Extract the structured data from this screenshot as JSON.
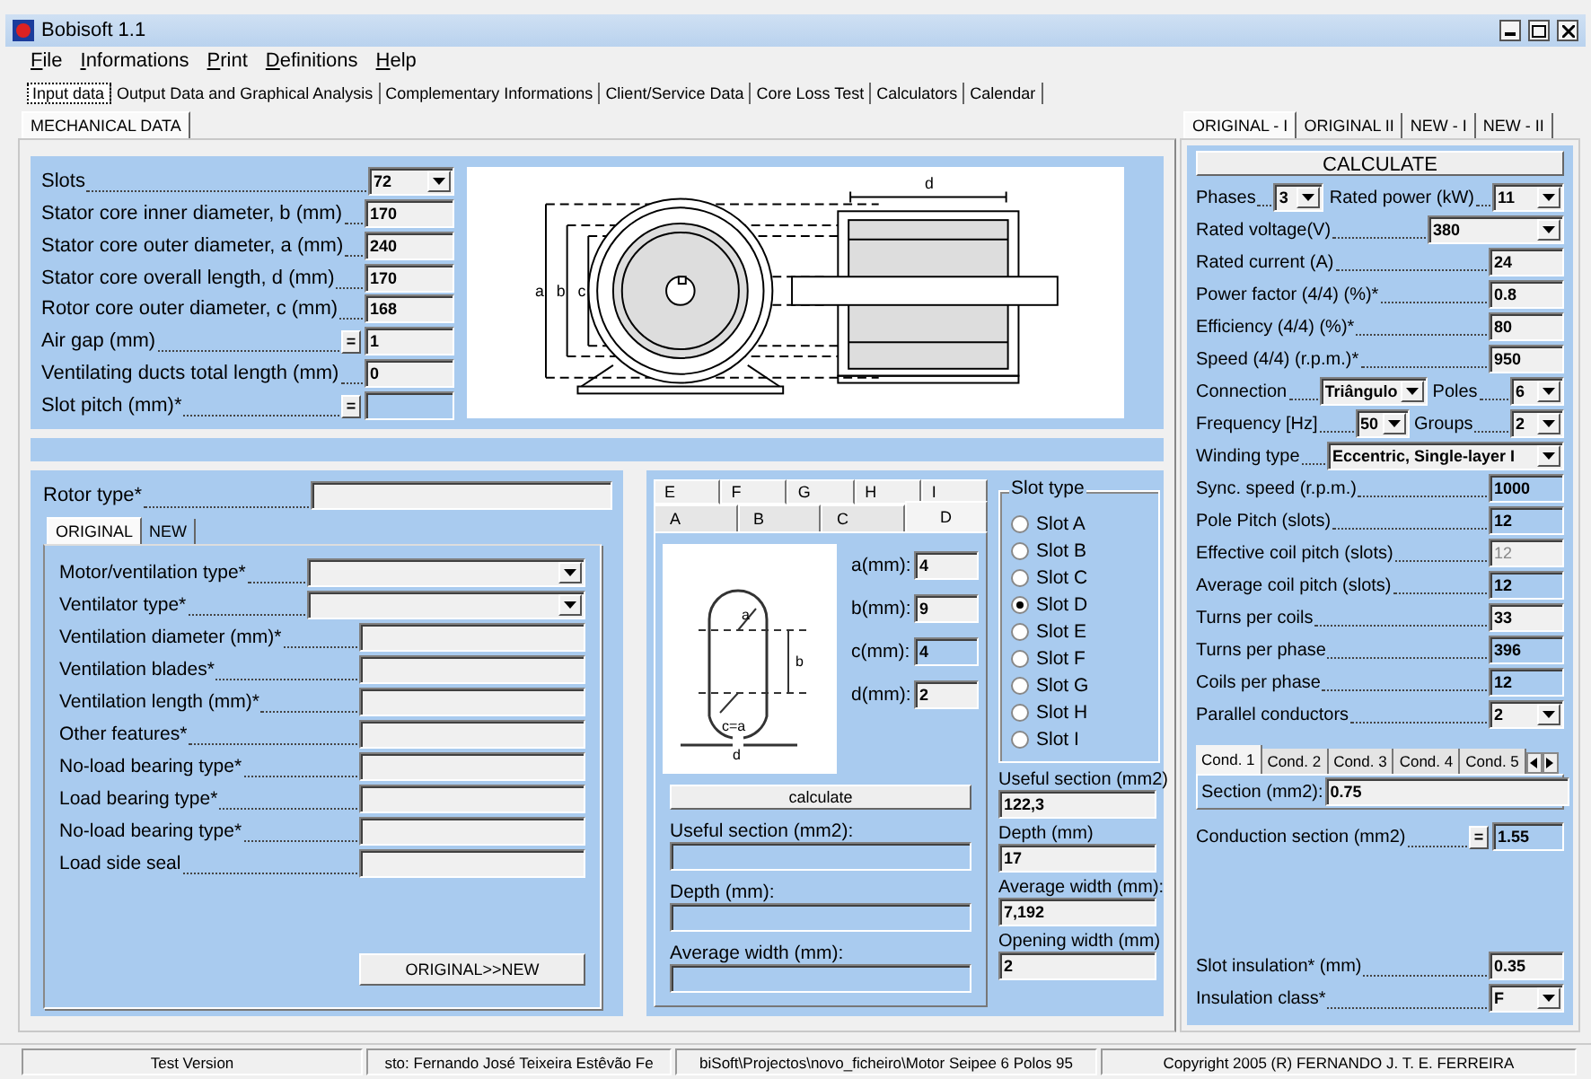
{
  "window": {
    "title": "Bobisoft 1.1"
  },
  "menu": [
    "File",
    "Informations",
    "Print",
    "Definitions",
    "Help"
  ],
  "main_tabs": [
    {
      "label": "Input data",
      "selected": true
    },
    {
      "label": "Output Data and Graphical Analysis",
      "selected": false
    },
    {
      "label": "Complementary Informations",
      "selected": false
    },
    {
      "label": "Client/Service Data",
      "selected": false
    },
    {
      "label": "Core Loss Test",
      "selected": false
    },
    {
      "label": "Calculators",
      "selected": false
    },
    {
      "label": "Calendar",
      "selected": false
    }
  ],
  "section_tabs": [
    {
      "label": "MECHANICAL DATA",
      "selected": true
    }
  ],
  "mechanical_fields": [
    {
      "label": "Slots",
      "value": "72",
      "kind": "select"
    },
    {
      "label": "Stator core inner diameter, b (mm)",
      "value": "170",
      "kind": "text"
    },
    {
      "label": "Stator core outer diameter, a (mm)",
      "value": "240",
      "kind": "text"
    },
    {
      "label": "Stator core overall length, d (mm)",
      "value": "170",
      "kind": "text"
    },
    {
      "label": "Rotor core outer diameter, c (mm)",
      "value": "168",
      "kind": "text"
    },
    {
      "label": "Air gap (mm)",
      "value": "1",
      "kind": "text",
      "button": "="
    },
    {
      "label": "Ventilating ducts total length (mm)",
      "value": "0",
      "kind": "text"
    },
    {
      "label": "Slot pitch (mm)*",
      "kind": "output",
      "button": "="
    }
  ],
  "motor_drawing_labels": [
    "a",
    "b",
    "c",
    "d"
  ],
  "rotor": {
    "label": "Rotor type*"
  },
  "ventilation_tabs": [
    {
      "label": "ORIGINAL",
      "selected": true
    },
    {
      "label": "NEW",
      "selected": false
    }
  ],
  "ventilation_fields": [
    {
      "label": "Motor/ventilation type*",
      "kind": "select"
    },
    {
      "label": "Ventilator type*",
      "kind": "select"
    },
    {
      "label": "Ventilation diameter (mm)*",
      "kind": "text"
    },
    {
      "label": "Ventilation blades*",
      "kind": "text"
    },
    {
      "label": "Ventilation length (mm)*",
      "kind": "text"
    },
    {
      "label": "Other features*",
      "kind": "text"
    },
    {
      "label": "No-load bearing type*",
      "kind": "text"
    },
    {
      "label": "Load bearing type*",
      "kind": "text"
    },
    {
      "label": "No-load bearing type*",
      "kind": "text"
    },
    {
      "label": "Load side seal",
      "kind": "text"
    }
  ],
  "copy_button": "ORIGINAL>>NEW",
  "slot_tabs_back": [
    {
      "label": "E",
      "selected": false
    },
    {
      "label": "F",
      "selected": false
    },
    {
      "label": "G",
      "selected": false
    },
    {
      "label": "H",
      "selected": false
    },
    {
      "label": "I",
      "selected": false
    }
  ],
  "slot_tabs_front": [
    {
      "label": "A",
      "selected": false
    },
    {
      "label": "B",
      "selected": false
    },
    {
      "label": "C",
      "selected": false
    },
    {
      "label": "D",
      "selected": true
    }
  ],
  "slot_drawing_labels": [
    "a",
    "b",
    "c=a",
    "d"
  ],
  "slot_dimensions": [
    {
      "label": "a(mm):",
      "value": "4",
      "kind": "text"
    },
    {
      "label": "b(mm):",
      "value": "9",
      "kind": "text"
    },
    {
      "label": "c(mm):",
      "value": "4",
      "kind": "output"
    },
    {
      "label": "d(mm):",
      "value": "2",
      "kind": "text"
    }
  ],
  "calculate_button": "calculate",
  "results_left": [
    {
      "label": "Useful section (mm2):"
    },
    {
      "label": "Depth (mm):"
    },
    {
      "label": "Average width (mm):"
    }
  ],
  "slot_type": {
    "title": "Slot type",
    "options": [
      {
        "label": "Slot A",
        "selected": false
      },
      {
        "label": "Slot B",
        "selected": false
      },
      {
        "label": "Slot C",
        "selected": false
      },
      {
        "label": "Slot D",
        "selected": true
      },
      {
        "label": "Slot E",
        "selected": false
      },
      {
        "label": "Slot F",
        "selected": false
      },
      {
        "label": "Slot G",
        "selected": false
      },
      {
        "label": "Slot H",
        "selected": false
      },
      {
        "label": "Slot I",
        "selected": false
      }
    ]
  },
  "results_right": [
    {
      "label": "Useful section (mm2)",
      "value": "122,3"
    },
    {
      "label": "Depth (mm)",
      "value": "17"
    },
    {
      "label": "Average width (mm):",
      "value": "7,192"
    },
    {
      "label": "Opening width (mm)",
      "value": "2"
    }
  ],
  "right_tabs": [
    {
      "label": "ORIGINAL - I",
      "selected": true
    },
    {
      "label": "ORIGINAL II",
      "selected": false
    },
    {
      "label": "NEW - I",
      "selected": false
    },
    {
      "label": "NEW - II",
      "selected": false
    }
  ],
  "right_calculate_button": "CALCULATE",
  "electrical_rows": [
    {
      "fields": [
        {
          "label": "Phases",
          "value": "3",
          "kind": "select"
        },
        {
          "label": "Rated power (kW)",
          "value": "11",
          "kind": "select"
        }
      ]
    },
    {
      "fields": [
        {
          "label": "Rated voltage(V)",
          "value": "380",
          "kind": "select"
        }
      ]
    },
    {
      "fields": [
        {
          "label": "Rated current (A)",
          "value": "24",
          "kind": "text"
        }
      ]
    },
    {
      "fields": [
        {
          "label": "Power factor (4/4) (%)*",
          "value": "0.8",
          "kind": "text"
        }
      ]
    },
    {
      "fields": [
        {
          "label": "Efficiency (4/4) (%)*",
          "value": "80",
          "kind": "text"
        }
      ]
    },
    {
      "fields": [
        {
          "label": "Speed (4/4) (r.p.m.)*",
          "value": "950",
          "kind": "text"
        }
      ]
    },
    {
      "fields": [
        {
          "label": "Connection",
          "value": "Triângulo",
          "kind": "select"
        },
        {
          "label": "Poles",
          "value": "6",
          "kind": "select"
        }
      ]
    },
    {
      "fields": [
        {
          "label": "Frequency [Hz]",
          "value": "50",
          "kind": "select"
        },
        {
          "label": "Groups",
          "value": "2",
          "kind": "select"
        }
      ]
    },
    {
      "fields": [
        {
          "label": "Winding type",
          "value": "Eccentric, Single-layer I",
          "kind": "select"
        }
      ]
    },
    {
      "fields": [
        {
          "label": "Sync. speed (r.p.m.)",
          "value": "1000",
          "kind": "output"
        }
      ]
    },
    {
      "fields": [
        {
          "label": "Pole Pitch (slots)",
          "value": "12",
          "kind": "output"
        }
      ]
    },
    {
      "fields": [
        {
          "label": "Effective coil pitch (slots)",
          "value": "12",
          "kind": "disabled"
        }
      ]
    },
    {
      "fields": [
        {
          "label": "Average coil pitch (slots)",
          "value": "12",
          "kind": "output"
        }
      ]
    },
    {
      "fields": [
        {
          "label": "Turns per coils",
          "value": "33",
          "kind": "text"
        }
      ]
    },
    {
      "fields": [
        {
          "label": "Turns per phase",
          "value": "396",
          "kind": "output"
        }
      ]
    },
    {
      "fields": [
        {
          "label": "Coils per phase",
          "value": "12",
          "kind": "output"
        }
      ]
    },
    {
      "fields": [
        {
          "label": "Parallel conductors",
          "value": "2",
          "kind": "select"
        }
      ]
    }
  ],
  "conductor_tabs": [
    {
      "label": "Cond. 1",
      "selected": true
    },
    {
      "label": "Cond. 2",
      "selected": false
    },
    {
      "label": "Cond. 3",
      "selected": false
    },
    {
      "label": "Cond. 4",
      "selected": false
    },
    {
      "label": "Cond. 5",
      "selected": false
    }
  ],
  "conductor_section": {
    "label": "Section (mm2):",
    "value": "0.75"
  },
  "conduction_section": {
    "label": "Conduction section (mm2)",
    "value": "1.55",
    "kind": "output",
    "button": "="
  },
  "insulation_fields": [
    {
      "label": "Slot insulation* (mm)",
      "value": "0.35",
      "kind": "text"
    },
    {
      "label": "Insulation class*",
      "value": "F",
      "kind": "select"
    }
  ],
  "status_bar": [
    "Test Version",
    "sto: Fernando José Teixeira Estêvão Fe",
    "biSoft\\Projectos\\novo_ficheiro\\Motor Seipee 6 Polos 95",
    "Copyright 2005 (R) FERNANDO J. T. E. FERREIRA"
  ]
}
